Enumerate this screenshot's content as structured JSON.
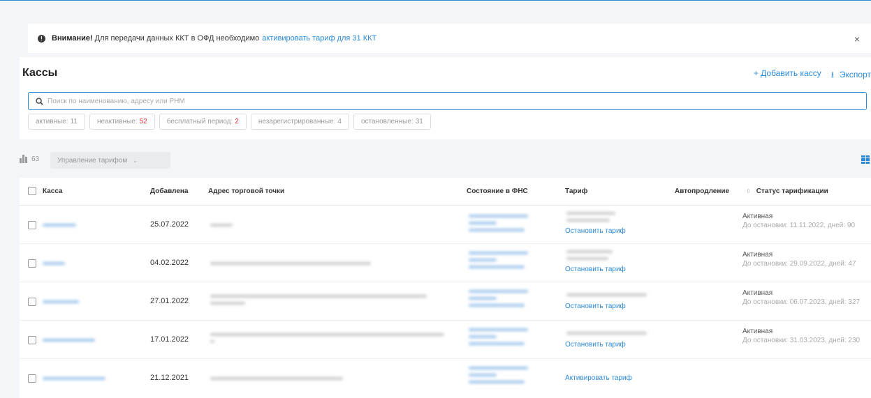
{
  "alert": {
    "title": "Внимание!",
    "text": "Для передачи данных ККТ в ОФД необходимо",
    "link": "активировать тариф для 31 ККТ",
    "close": "×"
  },
  "header": {
    "title": "Кассы",
    "add_button": "+ Добавить кассу",
    "export_button": "Экспорт"
  },
  "search": {
    "placeholder": "Поиск по наименованию, адресу или РНМ"
  },
  "filters": [
    {
      "label": "активные:",
      "count": "11"
    },
    {
      "label": "неактивные:",
      "count": "52"
    },
    {
      "label": "бесплатный период:",
      "count": "2"
    },
    {
      "label": "незарегистрированные:",
      "count": "4"
    },
    {
      "label": "остановленные:",
      "count": "31"
    }
  ],
  "toolbar": {
    "count": "63",
    "tariff_menu": "Управление тарифом"
  },
  "table": {
    "columns": {
      "kassa": "Касса",
      "added": "Добавлена",
      "address": "Адрес торговой точки",
      "fns": "Состояние в ФНС",
      "tariff": "Тариф",
      "autorenew": "Автопродление",
      "billing": "Статус тарификации"
    },
    "rows": [
      {
        "date": "25.07.2022",
        "action": "Остановить тариф",
        "autorenew": true,
        "status": "Активная",
        "detail": "До остановки: 11.11.2022, дней: 90"
      },
      {
        "date": "04.02.2022",
        "action": "Остановить тариф",
        "autorenew": false,
        "status": "Активная",
        "detail": "До остановки: 29.09.2022, дней: 47"
      },
      {
        "date": "27.01.2022",
        "action": "Остановить тариф",
        "autorenew": false,
        "status": "Активная",
        "detail": "До остановки: 06.07.2023, дней: 327"
      },
      {
        "date": "17.01.2022",
        "action": "Остановить тариф",
        "autorenew": false,
        "status": "Активная",
        "detail": "До остановки: 31.03.2023, дней: 230"
      },
      {
        "date": "21.12.2021",
        "action": "Активировать тариф",
        "autorenew": null,
        "status": "",
        "detail": ""
      }
    ]
  },
  "colors": {
    "accent": "#2b8ad8",
    "danger": "#e0323a"
  },
  "icons": [
    "warning-icon",
    "close-icon",
    "search-icon",
    "download-icon",
    "building-icon",
    "chevron-down-icon",
    "grid-view-icon",
    "sort-icon"
  ]
}
